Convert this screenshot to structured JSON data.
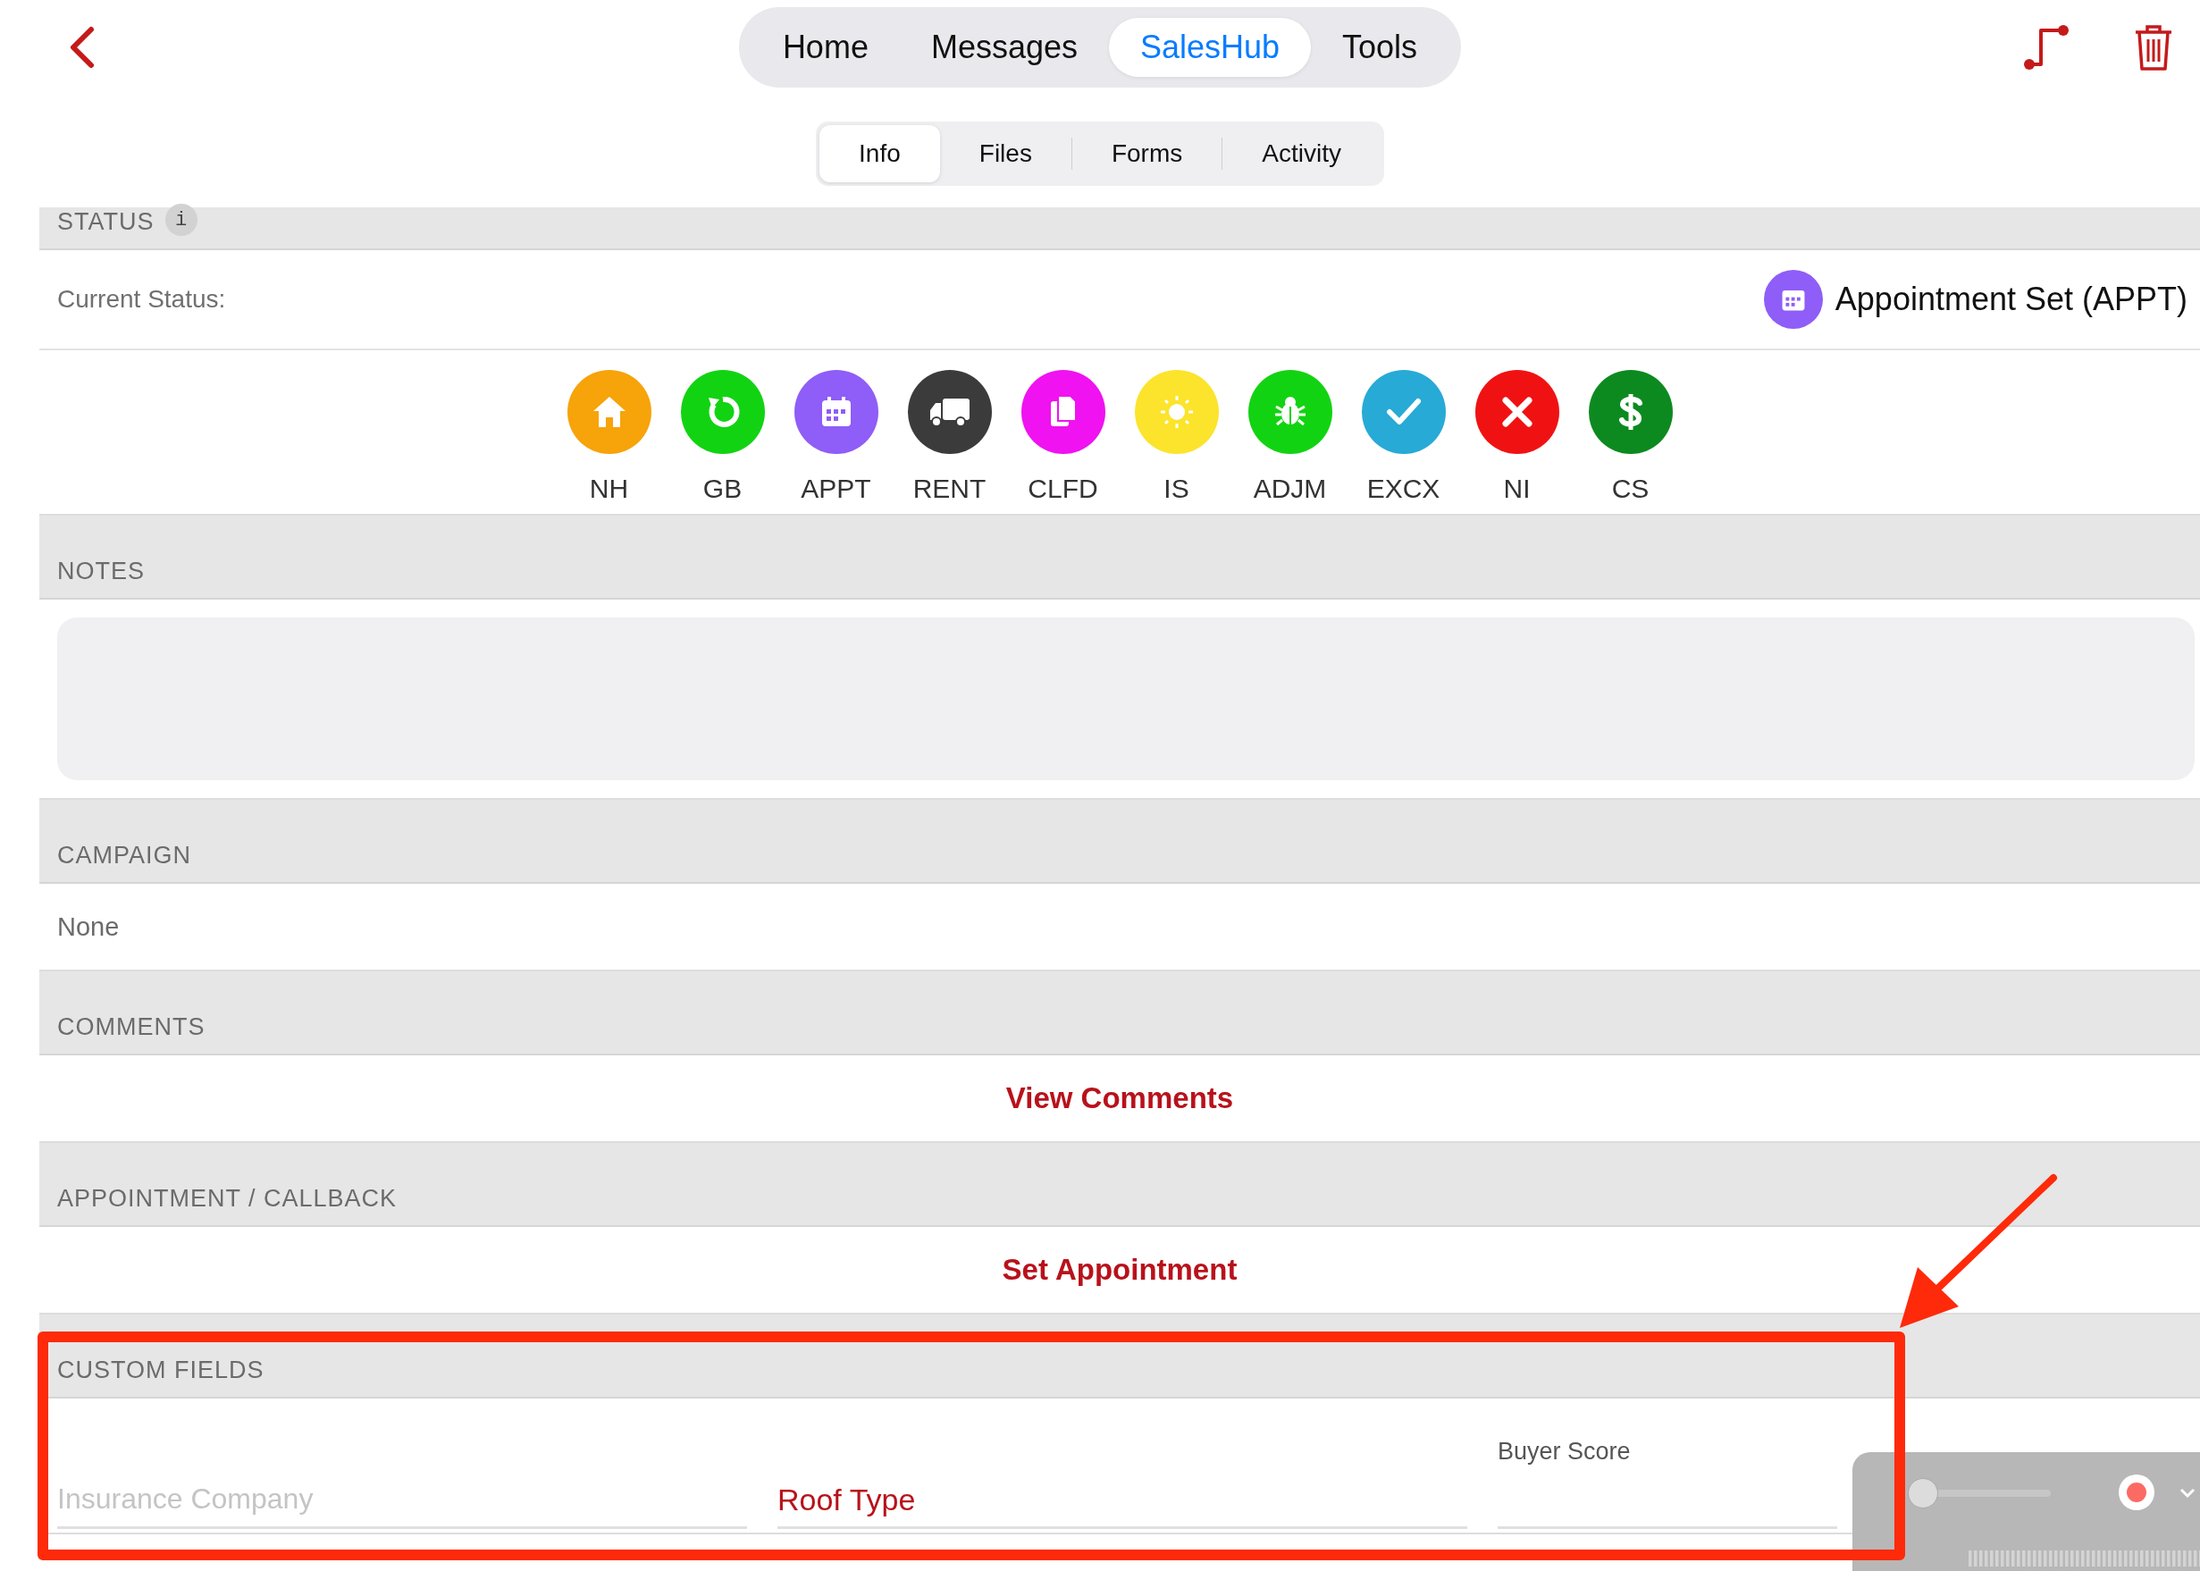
{
  "top_bar": {
    "nav_tabs": [
      {
        "label": "Home",
        "selected": false
      },
      {
        "label": "Messages",
        "selected": false
      },
      {
        "label": "SalesHub",
        "selected": true
      },
      {
        "label": "Tools",
        "selected": false
      }
    ],
    "sub_tabs": [
      {
        "label": "Info",
        "selected": true
      },
      {
        "label": "Files",
        "selected": false
      },
      {
        "label": "Forms",
        "selected": false
      },
      {
        "label": "Activity",
        "selected": false
      }
    ]
  },
  "status": {
    "header": "STATUS",
    "info_badge": "i",
    "current_label": "Current Status:",
    "current_value": "Appointment Set (APPT)",
    "options": [
      {
        "label": "NH",
        "color": "#f7a30a"
      },
      {
        "label": "GB",
        "color": "#12d312"
      },
      {
        "label": "APPT",
        "color": "#8f5df7"
      },
      {
        "label": "RENT",
        "color": "#3b3b3b"
      },
      {
        "label": "CLFD",
        "color": "#f012f0"
      },
      {
        "label": "IS",
        "color": "#fbe42b"
      },
      {
        "label": "ADJM",
        "color": "#12d312"
      },
      {
        "label": "EXCX",
        "color": "#27aad6"
      },
      {
        "label": "NI",
        "color": "#f01212"
      },
      {
        "label": "CS",
        "color": "#0c8a1f"
      }
    ]
  },
  "notes": {
    "header": "NOTES"
  },
  "campaign": {
    "header": "CAMPAIGN",
    "value": "None"
  },
  "comments": {
    "header": "COMMENTS",
    "action": "View Comments"
  },
  "appointment": {
    "header": "APPOINTMENT / CALLBACK",
    "action": "Set Appointment"
  },
  "custom_fields": {
    "header": "CUSTOM FIELDS",
    "fields": [
      {
        "kind": "text",
        "placeholder": "Insurance Company"
      },
      {
        "kind": "picker",
        "value": "Roof Type"
      },
      {
        "kind": "labeled",
        "label": "Buyer Score"
      }
    ]
  },
  "recorder": {
    "level": 0.04
  }
}
